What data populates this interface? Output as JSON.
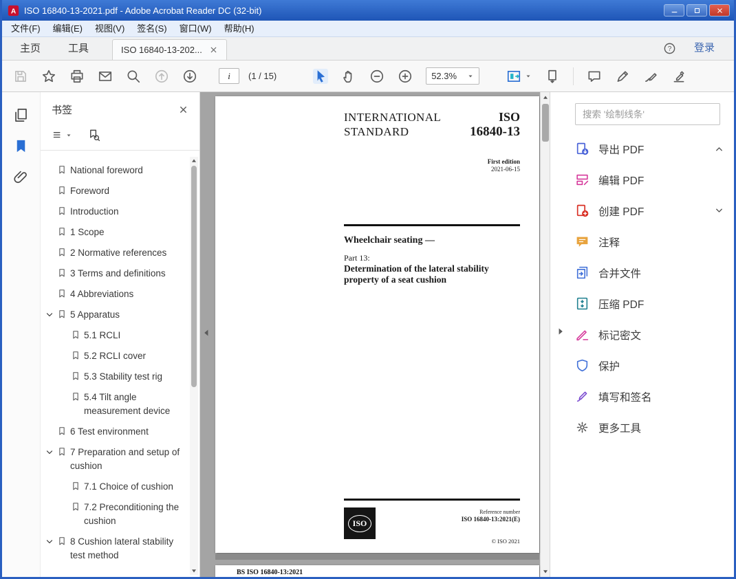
{
  "window": {
    "title": "ISO 16840-13-2021.pdf - Adobe Acrobat Reader DC (32-bit)",
    "menus": [
      "文件(F)",
      "编辑(E)",
      "视图(V)",
      "签名(S)",
      "窗口(W)",
      "帮助(H)"
    ]
  },
  "tabbar": {
    "home": "主页",
    "tools": "工具",
    "document_tab": "ISO 16840-13-202...",
    "signin": "登录"
  },
  "toolbar": {
    "page_input": "i",
    "page_count": "(1 / 15)",
    "zoom_level": "52.3%"
  },
  "bookmarks": {
    "title": "书签",
    "items": [
      {
        "label": "National foreword",
        "level": 0
      },
      {
        "label": "Foreword",
        "level": 0
      },
      {
        "label": "Introduction",
        "level": 0
      },
      {
        "label": "1 Scope",
        "level": 0
      },
      {
        "label": "2 Normative references",
        "level": 0
      },
      {
        "label": "3 Terms and definitions",
        "level": 0
      },
      {
        "label": "4 Abbreviations",
        "level": 0
      },
      {
        "label": "5 Apparatus",
        "level": 0,
        "expanded": true
      },
      {
        "label": "5.1 RCLI",
        "level": 1
      },
      {
        "label": "5.2 RCLI cover",
        "level": 1
      },
      {
        "label": "5.3 Stability test rig",
        "level": 1
      },
      {
        "label": "5.4 Tilt angle measurement device",
        "level": 1
      },
      {
        "label": "6 Test environment",
        "level": 0
      },
      {
        "label": "7 Preparation and setup of cushion",
        "level": 0,
        "expanded": true
      },
      {
        "label": "7.1 Choice of cushion",
        "level": 1
      },
      {
        "label": "7.2 Preconditioning the cushion",
        "level": 1
      },
      {
        "label": "8 Cushion lateral stability test method",
        "level": 0,
        "expanded": true
      }
    ]
  },
  "document": {
    "page1": {
      "std_label_line1": "INTERNATIONAL",
      "std_label_line2": "STANDARD",
      "iso_label": "ISO",
      "std_number": "16840-13",
      "edition": "First edition",
      "edition_date": "2021-06-15",
      "title": "Wheelchair seating —",
      "part_label": "Part 13:",
      "subtitle": "Determination of the lateral stability property of a seat cushion",
      "logo_text": "ISO",
      "reference_label": "Reference number",
      "reference_number": "ISO 16840-13:2021(E)",
      "copyright": "© ISO 2021"
    },
    "page2": {
      "header": "BS ISO 16840-13:2021"
    }
  },
  "right_panel": {
    "search_placeholder": "搜索 '绘制线条'",
    "tools": [
      {
        "label": "导出 PDF",
        "icon": "export-pdf-icon",
        "color": "#4a63d8",
        "chevron": "chevron-up-icon"
      },
      {
        "label": "编辑 PDF",
        "icon": "edit-pdf-icon",
        "color": "#d6399b"
      },
      {
        "label": "创建 PDF",
        "icon": "create-pdf-icon",
        "color": "#d93025",
        "chevron": "chevron-down-icon"
      },
      {
        "label": "注释",
        "icon": "comment-icon",
        "color": "#e8a33d"
      },
      {
        "label": "合并文件",
        "icon": "combine-files-icon",
        "color": "#3f6fd8"
      },
      {
        "label": "压缩 PDF",
        "icon": "compress-pdf-icon",
        "color": "#1d7f8f"
      },
      {
        "label": "标记密文",
        "icon": "redact-icon",
        "color": "#d6399b"
      },
      {
        "label": "保护",
        "icon": "protect-icon",
        "color": "#3f6fd8"
      },
      {
        "label": "填写和签名",
        "icon": "fill-sign-icon",
        "color": "#7a4bd0"
      },
      {
        "label": "更多工具",
        "icon": "more-tools-icon",
        "color": "#555555"
      }
    ]
  },
  "colors": {
    "titlebar_blue": "#2a5fc0",
    "accent_blue": "#2a6fd4",
    "close_red": "#c0392b",
    "doc_background": "#a4a4a4"
  },
  "icons": {
    "acrobat-icon": "red-square-A",
    "save-icon": "floppy-disk",
    "star-icon": "star",
    "print-icon": "printer",
    "email-icon": "envelope",
    "search-icon": "magnifier",
    "share-icon": "circle-up-arrow",
    "download-arrow-icon": "circle-down-arrow",
    "select-tool-icon": "cursor-arrow",
    "hand-tool-icon": "hand",
    "zoom-out-icon": "circle-minus",
    "zoom-in-icon": "circle-plus",
    "page-fit-icon": "page-fit",
    "scroll-mode-icon": "page-scroll",
    "comment-tool-icon": "speech-bubble",
    "highlight-icon": "highlighter",
    "sign-icon": "fountain-pen",
    "stamp-icon": "ink-pen",
    "pages-icon": "page-thumbnails",
    "bookmarks-rail-icon": "bookmark-ribbon-filled",
    "paperclip-icon": "paperclip",
    "close-icon": "x",
    "options-icon": "menu-lines",
    "find-bookmark-icon": "bookmark-magnifier",
    "help-icon": "circle-question",
    "chevron-down-icon": "chevron-down",
    "chevron-up-icon": "chevron-up",
    "caret-down-icon": "caret-down",
    "collapse-left-icon": "triangle-left",
    "collapse-right-icon": "triangle-right",
    "scroll-up-icon": "triangle-up",
    "scroll-down-icon": "triangle-down",
    "bookmark-ribbon-icon": "bookmark-ribbon",
    "minimize-icon": "minimize-line",
    "maximize-icon": "maximize-box",
    "export-pdf-icon": "page-down-arrow",
    "edit-pdf-icon": "rects-pencil",
    "create-pdf-icon": "page-plus",
    "comment-icon": "speech-bubble-filled",
    "combine-files-icon": "stacked-pages",
    "compress-pdf-icon": "page-compress-arrows",
    "redact-icon": "pen-strike",
    "protect-icon": "shield",
    "fill-sign-icon": "pen-nib-signature",
    "more-tools-icon": "gear"
  }
}
